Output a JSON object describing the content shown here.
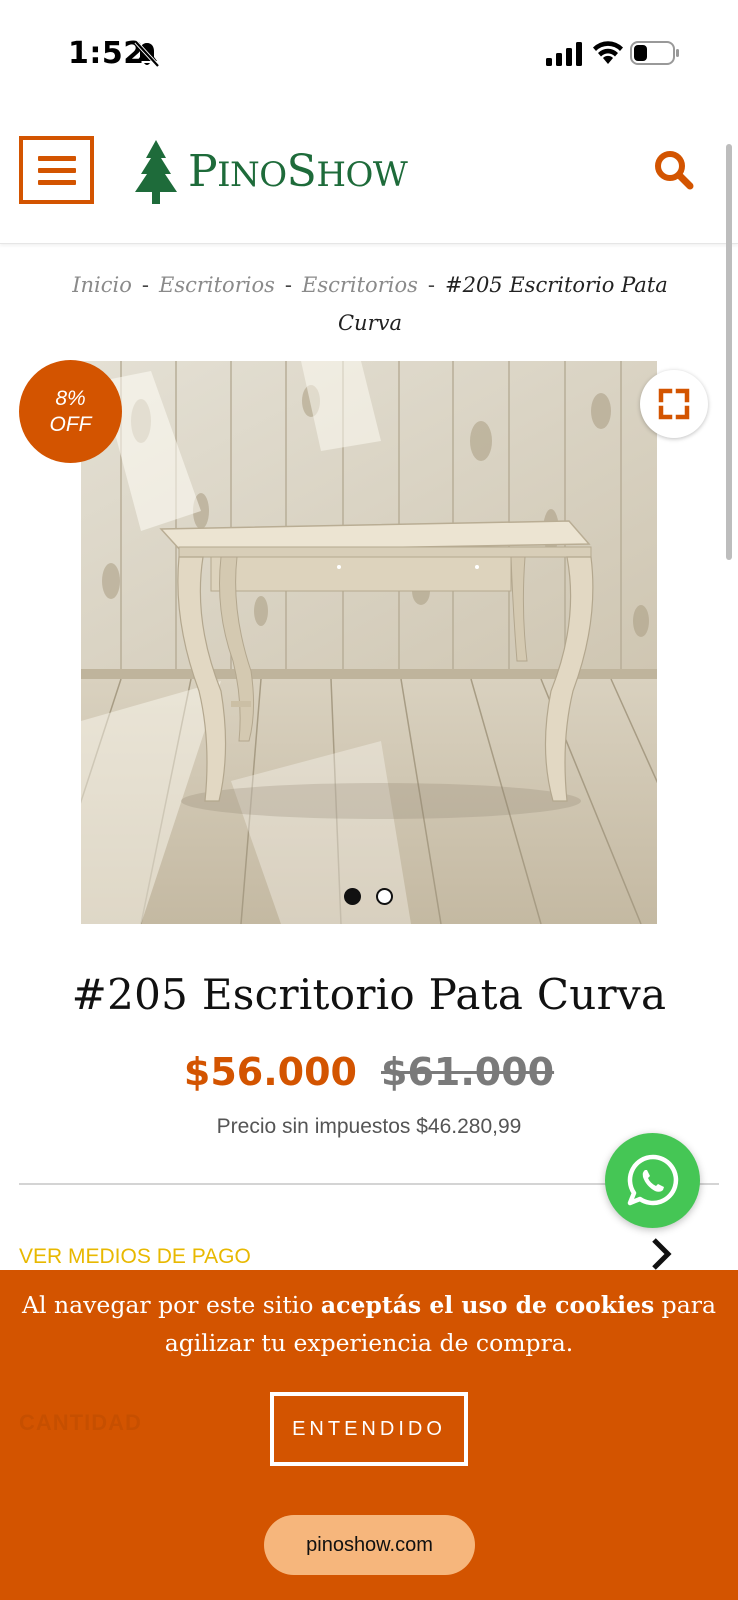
{
  "status_bar": {
    "time": "1:52",
    "icons": [
      "bell-slash-icon",
      "signal-icon",
      "wifi-icon",
      "battery-icon"
    ]
  },
  "header": {
    "logo_letter_1": "P",
    "logo_small_1": "INO",
    "logo_letter_2": "S",
    "logo_small_2": "HOW",
    "icons": [
      "menu-icon",
      "search-icon"
    ]
  },
  "breadcrumb": {
    "items": [
      "Inicio",
      "Escritorios",
      "Escritorios"
    ],
    "separator": "-",
    "current": "#205 Escritorio Pata Curva"
  },
  "product": {
    "discount_percent": "8%",
    "discount_label": "OFF",
    "title": "#205 Escritorio Pata Curva",
    "price": "$56.000",
    "original_price": "$61.000",
    "price_no_tax": "Precio sin impuestos $46.280,99",
    "carousel": {
      "total": 2,
      "active": 1
    },
    "payment_link": "VER MEDIOS DE PAGO"
  },
  "cookie_banner": {
    "text_before": "Al navegar por este sitio ",
    "text_bold": "aceptás el uso de cookies",
    "text_after": " para agilizar tu experiencia de compra.",
    "button_label": "ENTENDIDO",
    "behind_label": "CANTIDAD"
  },
  "browser": {
    "url": "pinoshow.com"
  },
  "colors": {
    "brand_orange": "#d35400",
    "logo_green": "#1e6b3a",
    "payment_link": "#e8b800",
    "whatsapp": "#45c655"
  }
}
